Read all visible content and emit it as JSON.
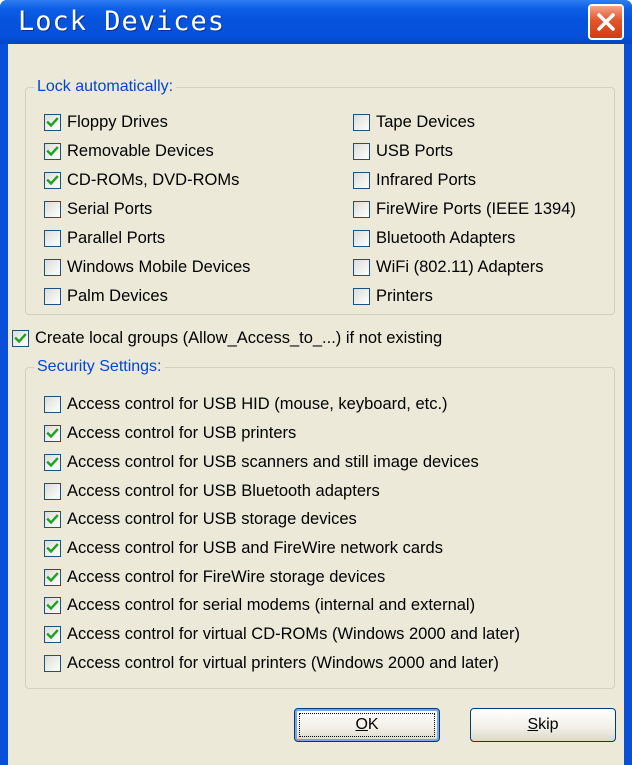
{
  "window": {
    "title": "Lock Devices"
  },
  "lock_group": {
    "legend": "Lock automatically:",
    "items": [
      {
        "label": "Floppy Drives",
        "checked": true
      },
      {
        "label": "Removable Devices",
        "checked": true
      },
      {
        "label": "CD-ROMs, DVD-ROMs",
        "checked": true
      },
      {
        "label": "Serial Ports",
        "checked": false
      },
      {
        "label": "Parallel Ports",
        "checked": false
      },
      {
        "label": "Windows Mobile Devices",
        "checked": false
      },
      {
        "label": "Palm Devices",
        "checked": false
      },
      {
        "label": "Tape Devices",
        "checked": false
      },
      {
        "label": "USB Ports",
        "checked": false
      },
      {
        "label": "Infrared Ports",
        "checked": false
      },
      {
        "label": "FireWire Ports (IEEE 1394)",
        "checked": false
      },
      {
        "label": "Bluetooth Adapters",
        "checked": false
      },
      {
        "label": "WiFi (802.11) Adapters",
        "checked": false
      },
      {
        "label": "Printers",
        "checked": false
      }
    ]
  },
  "create_groups": {
    "label": "Create local groups (Allow_Access_to_...) if not existing",
    "checked": true
  },
  "security_group": {
    "legend": "Security Settings:",
    "items": [
      {
        "label": "Access control for USB HID (mouse, keyboard, etc.)",
        "checked": false
      },
      {
        "label": "Access control for USB printers",
        "checked": true
      },
      {
        "label": "Access control for USB scanners and still image devices",
        "checked": true
      },
      {
        "label": "Access control for USB Bluetooth adapters",
        "checked": false
      },
      {
        "label": "Access control for USB storage devices",
        "checked": true
      },
      {
        "label": "Access control for USB and FireWire network cards",
        "checked": true
      },
      {
        "label": "Access control for FireWire storage devices",
        "checked": true
      },
      {
        "label": "Access control for serial modems (internal and external)",
        "checked": true
      },
      {
        "label": "Access control for virtual CD-ROMs (Windows 2000 and later)",
        "checked": true
      },
      {
        "label": "Access control for virtual printers (Windows 2000 and later)",
        "checked": false
      }
    ]
  },
  "buttons": {
    "ok": {
      "mnemonic": "O",
      "rest": "K"
    },
    "skip": {
      "mnemonic": "S",
      "rest": "kip"
    }
  },
  "colors": {
    "title_bar": "#0552dd",
    "legend_text": "#0046d5",
    "check_mark": "#21a121",
    "close_button": "#d43b12"
  }
}
